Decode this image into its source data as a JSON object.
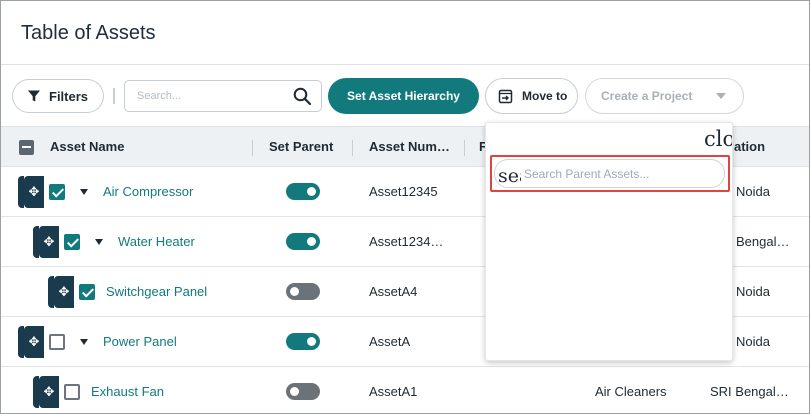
{
  "page": {
    "title": "Table of Assets"
  },
  "toolbar": {
    "filters_label": "Filters",
    "search_placeholder": "Search...",
    "set_hierarchy_label": "Set Asset Hierarchy",
    "move_to_label": "Move to",
    "create_project_label": "Create a Project"
  },
  "table": {
    "headers": {
      "asset_name": "Asset Name",
      "set_parent": "Set Parent",
      "asset_number": "Asset Num…",
      "hidden_col": "F",
      "location": "ation"
    },
    "rows": [
      {
        "name": "Air Compressor",
        "checked": true,
        "expandable": true,
        "parent": true,
        "number": "Asset12345",
        "category": "",
        "location": "Noida"
      },
      {
        "name": "Water Heater",
        "checked": true,
        "expandable": true,
        "parent": true,
        "number": "Asset1234…",
        "category": "",
        "location": "Bengal…"
      },
      {
        "name": "Switchgear Panel",
        "checked": true,
        "expandable": false,
        "parent": false,
        "number": "AssetA4",
        "category": "",
        "location": "Noida"
      },
      {
        "name": "Power Panel",
        "checked": false,
        "expandable": true,
        "parent": true,
        "number": "AssetA",
        "category": "",
        "location": "Noida"
      },
      {
        "name": "Exhaust Fan",
        "checked": false,
        "expandable": false,
        "parent": false,
        "number": "AssetA1",
        "category": "Air Cleaners",
        "location": "SRI Bengal…"
      }
    ]
  },
  "popup": {
    "close_glyph_text": "clo",
    "search_glyph_text": "sea",
    "search_placeholder": "Search Parent Assets..."
  },
  "colors": {
    "accent": "#127a7c",
    "drag_handle": "#1a3a4e",
    "highlight": "#e0443e"
  },
  "icons": {
    "filters": "filter-funnel-icon",
    "search": "search-icon",
    "move_to": "move-to-icon",
    "create_project_caret": "chevron-down-icon",
    "drag": "drag-move-icon",
    "expand": "caret-down-icon"
  }
}
